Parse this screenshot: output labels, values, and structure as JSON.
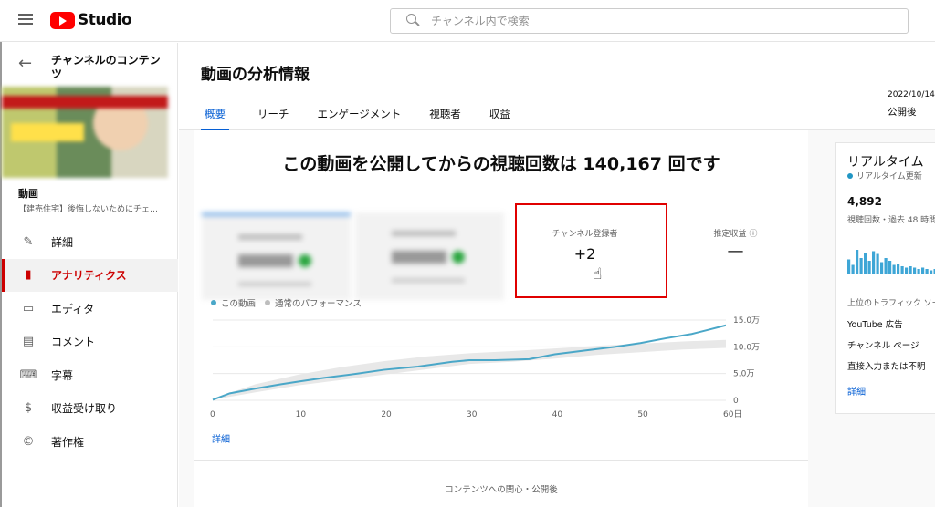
{
  "app": {
    "logo_text": "Studio",
    "search_placeholder": "チャンネル内で検索"
  },
  "sidebar": {
    "back_title": "チャンネルのコンテンツ",
    "video_label": "動画",
    "video_title": "【建売住宅】後悔しないためにチェ…",
    "items": [
      {
        "label": "詳細",
        "icon": "pencil-icon",
        "glyph": "✎",
        "active": false
      },
      {
        "label": "アナリティクス",
        "icon": "analytics-icon",
        "glyph": "▮",
        "active": true
      },
      {
        "label": "エディタ",
        "icon": "editor-icon",
        "glyph": "▭",
        "active": false
      },
      {
        "label": "コメント",
        "icon": "comment-icon",
        "glyph": "▤",
        "active": false
      },
      {
        "label": "字幕",
        "icon": "subtitles-icon",
        "glyph": "⌨",
        "active": false
      },
      {
        "label": "収益受け取り",
        "icon": "monetization-icon",
        "glyph": "$",
        "active": false
      },
      {
        "label": "著作権",
        "icon": "copyright-icon",
        "glyph": "©",
        "active": false
      }
    ]
  },
  "main": {
    "title": "動画の分析情報",
    "tabs": [
      {
        "label": "概要",
        "active": true
      },
      {
        "label": "リーチ",
        "active": false
      },
      {
        "label": "エンゲージメント",
        "active": false
      },
      {
        "label": "視聴者",
        "active": false
      },
      {
        "label": "収益",
        "active": false
      }
    ],
    "publish_date": "2022/10/14",
    "publish_after": "公開後",
    "headline": "この動画を公開してからの視聴回数は 140,167 回です",
    "metrics": {
      "subscribers_label": "チャンネル登録者",
      "subscribers_value": "+2",
      "revenue_label": "推定収益",
      "revenue_value": "—"
    },
    "legend": {
      "this_video": "この動画",
      "typical": "通常のパフォーマンス"
    },
    "detail_link": "詳細",
    "footer": "コンテンツへの関心・公開後"
  },
  "colors": {
    "accent": "#065fd4",
    "line": "#4aa7c8",
    "band": "#e8e8e8",
    "active_red": "#cc0000",
    "highlight": "#e00000"
  },
  "chart_data": {
    "type": "line",
    "x_ticks": [
      "0",
      "10",
      "20",
      "30",
      "40",
      "50",
      "60日"
    ],
    "y_ticks": [
      "0",
      "5.0万",
      "10.0万",
      "15.0万"
    ],
    "xlim": [
      0,
      60
    ],
    "ylim": [
      0,
      150000
    ],
    "series": [
      {
        "name": "この動画",
        "x": [
          0,
          2,
          5,
          8,
          10,
          13,
          17,
          20,
          24,
          28,
          30,
          33,
          37,
          40,
          43,
          47,
          50,
          53,
          56,
          58,
          60
        ],
        "y": [
          1000,
          13000,
          22000,
          30000,
          35000,
          42000,
          50000,
          57000,
          63000,
          72000,
          75000,
          75000,
          77000,
          86000,
          92000,
          100000,
          107000,
          116000,
          124000,
          132000,
          140167
        ]
      },
      {
        "name": "通常のパフォーマンス",
        "x": [
          0,
          5,
          10,
          15,
          20,
          25,
          30,
          35,
          40,
          45,
          50,
          55,
          60
        ],
        "y_low": [
          1000,
          15000,
          28000,
          38000,
          48000,
          58000,
          68000,
          72000,
          78000,
          85000,
          90000,
          95000,
          98000
        ],
        "y_high": [
          3000,
          30000,
          48000,
          62000,
          73000,
          82000,
          88000,
          92000,
          97000,
          102000,
          106000,
          110000,
          113000
        ]
      }
    ],
    "grid": true,
    "legend": "top-left"
  },
  "realtime": {
    "title": "リアルタイム",
    "subtitle": "リアルタイム更新",
    "count": "4,892",
    "count_label": "視聴回数・過去 48 時間",
    "bars": [
      0.55,
      0.35,
      0.9,
      0.6,
      0.8,
      0.5,
      0.85,
      0.75,
      0.45,
      0.6,
      0.5,
      0.35,
      0.4,
      0.3,
      0.25,
      0.3,
      0.25,
      0.2,
      0.25,
      0.2,
      0.15,
      0.2
    ],
    "traffic_title": "上位のトラフィック ソース",
    "sources": [
      "YouTube 広告",
      "チャンネル ページ",
      "直接入力または不明"
    ],
    "detail_link": "詳細"
  }
}
